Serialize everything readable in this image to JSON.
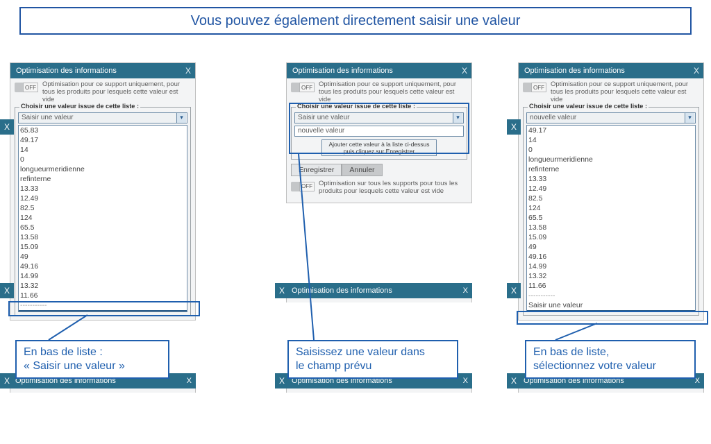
{
  "banner_text": "Vous pouvez également directement saisir une valeur",
  "dialog_title": "Optimisation des informations",
  "close_x": "X",
  "toggle_off_label": "OFF",
  "toggle_desc_top": "Optimisation pour ce support uniquement, pour tous les produits pour lesquels cette valeur est vide",
  "toggle_desc_bottom": "Optimisation sur tous les supports pour tous les produits pour lesquels cette valeur est vide",
  "fieldset_legend": "Choisir une valeur issue de cette liste :",
  "dd_placeholder": "Saisir une valeur",
  "list_values": [
    "65.83",
    "49.17",
    "14",
    "0",
    "longueurmeridienne",
    "refinterne",
    "13.33",
    "12.49",
    "82.5",
    "124",
    "65.5",
    "13.58",
    "15.09",
    "49",
    "49.16",
    "14.99",
    "13.32",
    "11.66"
  ],
  "list_selected_label": "Saisir une valeur",
  "listbox_dotted": "-----------",
  "panel2_input_value": "nouvelle valeur",
  "panel2_add_hint_top": "Ajouter cette valeur à la liste ci-dessus",
  "panel2_add_hint_bot": "puis cliquez sur Enregistrer",
  "btn_save": "Enregistrer",
  "btn_cancel": "Annuler",
  "panel3_dd_value": "nouvelle valeur",
  "panel3_list_values": [
    "49.17",
    "14",
    "0",
    "longueurmeridienne",
    "refinterne",
    "13.33",
    "12.49",
    "82.5",
    "124",
    "65.5",
    "13.58",
    "15.09",
    "49",
    "49.16",
    "14.99",
    "13.32",
    "11.66"
  ],
  "panel3_extra_txt": "Saisir une valeur",
  "panel3_selected_label": "nouvelle valeur",
  "callout1_a": "En bas de liste :",
  "callout1_b": "« Saisir une valeur »",
  "callout2_a": "Saisissez une valeur dans",
  "callout2_b": "le champ prévu",
  "callout3_a": "En bas de liste,",
  "callout3_b": "sélectionnez votre valeur"
}
